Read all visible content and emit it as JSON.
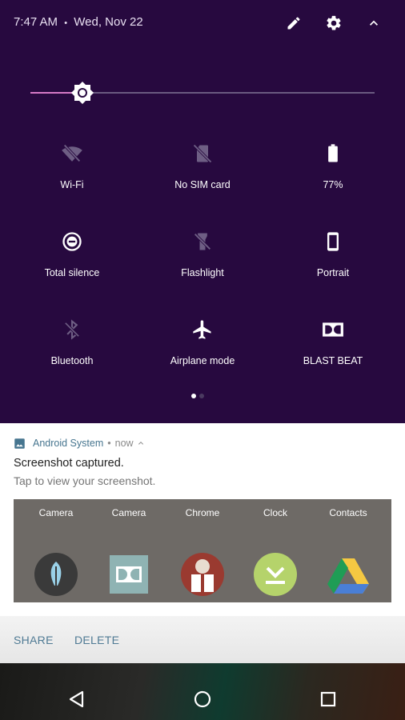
{
  "status": {
    "time": "7:47 AM",
    "separator": "•",
    "date": "Wed, Nov 22"
  },
  "header_icons": [
    "edit-icon",
    "settings-gear-icon",
    "collapse-chevron-up-icon"
  ],
  "brightness": {
    "level": 0.15
  },
  "tiles": [
    {
      "label": "Wi-Fi",
      "icon": "wifi-off-icon"
    },
    {
      "label": "No SIM card",
      "icon": "no-sim-icon"
    },
    {
      "label": "77%",
      "icon": "battery-icon"
    },
    {
      "label": "Total silence",
      "icon": "total-silence-icon"
    },
    {
      "label": "Flashlight",
      "icon": "flashlight-off-icon"
    },
    {
      "label": "Portrait",
      "icon": "portrait-rotation-icon"
    },
    {
      "label": "Bluetooth",
      "icon": "bluetooth-off-icon"
    },
    {
      "label": "Airplane mode",
      "icon": "airplane-icon"
    },
    {
      "label": "BLAST BEAT",
      "icon": "dolby-icon"
    }
  ],
  "pager": {
    "pages": 2,
    "current": 1
  },
  "notification": {
    "app": "Android System",
    "separator": "•",
    "time": "now",
    "title": "Screenshot captured.",
    "text": "Tap to view your screenshot.",
    "preview_apps": [
      "Camera",
      "Camera",
      "Chrome",
      "Clock",
      "Contacts"
    ],
    "preview_icons": [
      "feather-app-icon",
      "dolby-app-icon",
      "reader-app-icon",
      "download-app-icon",
      "drive-app-icon"
    ],
    "actions": {
      "share": "SHARE",
      "delete": "DELETE"
    }
  },
  "navbar": [
    "back-icon",
    "home-icon",
    "recents-icon"
  ],
  "colors": {
    "panel": "#27093f",
    "accent": "#d67ac6",
    "notif_app": "#46758f"
  }
}
